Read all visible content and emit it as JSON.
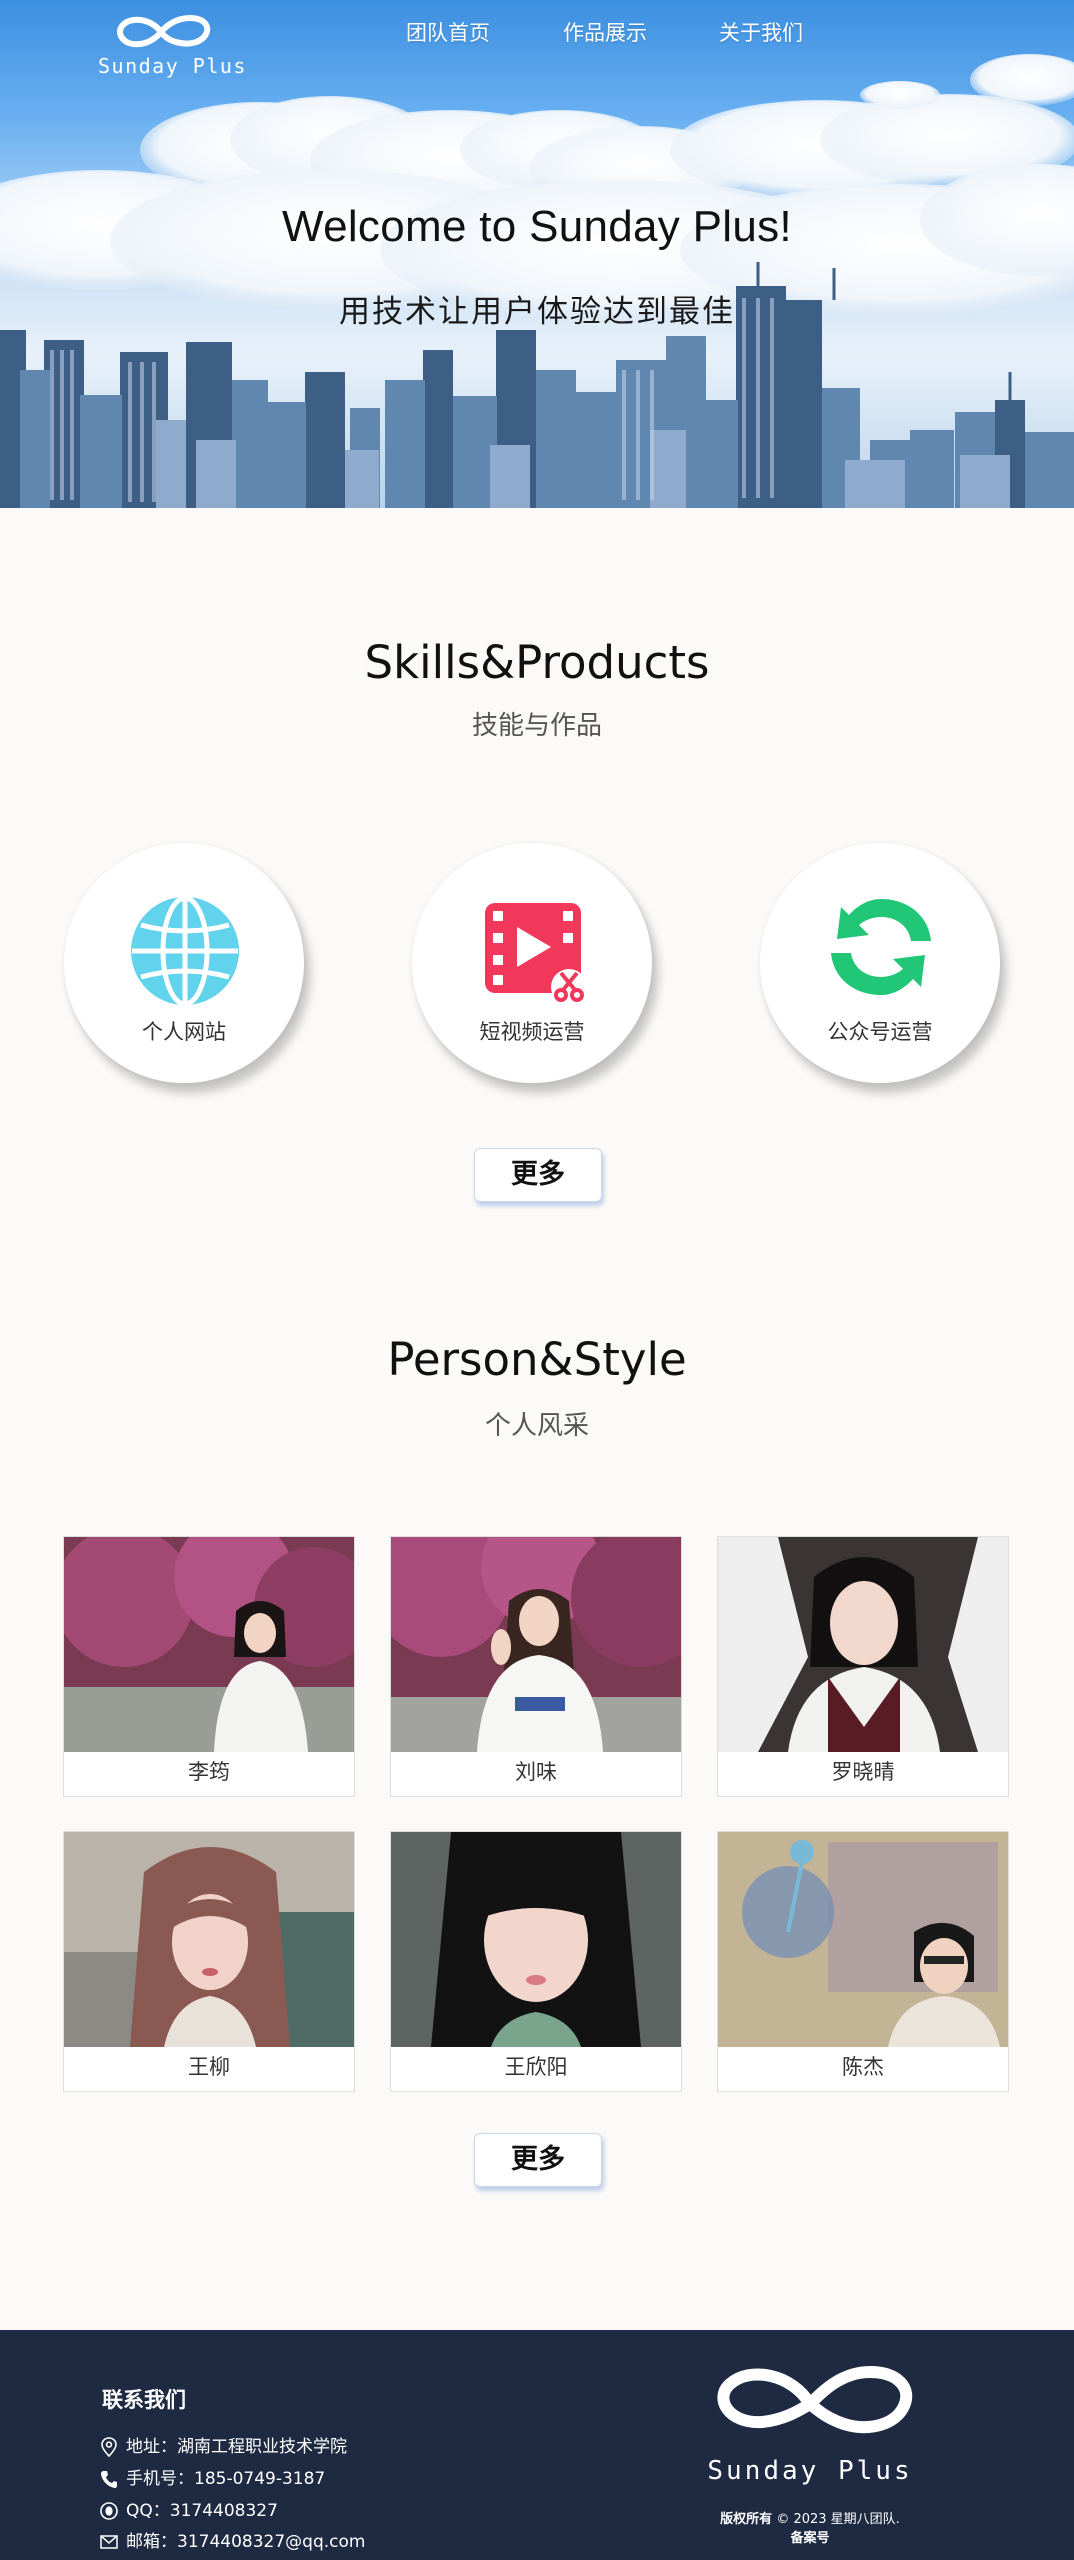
{
  "brand": {
    "logo_text": "Sunday Plus",
    "logo_icon": "infinity-icon"
  },
  "nav": {
    "items": [
      {
        "label": "团队首页"
      },
      {
        "label": "作品展示"
      },
      {
        "label": "关于我们"
      }
    ]
  },
  "hero": {
    "title": "Welcome to Sunday Plus!",
    "subtitle": "用技术让用户体验达到最佳"
  },
  "skills": {
    "title": "Skills&Products",
    "subtitle": "技能与作品",
    "items": [
      {
        "label": "个人网站",
        "icon": "globe-icon",
        "color": "#62d3ec"
      },
      {
        "label": "短视频运营",
        "icon": "video-editing-icon",
        "color": "#f2385a"
      },
      {
        "label": "公众号运营",
        "icon": "wechat-official-account-icon",
        "color": "#21c777"
      }
    ],
    "more_label": "更多"
  },
  "people": {
    "title": "Person&Style",
    "subtitle": "个人风采",
    "members": [
      {
        "name": "李筠"
      },
      {
        "name": "刘味"
      },
      {
        "name": "罗晓晴"
      },
      {
        "name": "王柳"
      },
      {
        "name": "王欣阳"
      },
      {
        "name": "陈杰"
      }
    ],
    "more_label": "更多"
  },
  "footer": {
    "contact_title": "联系我们",
    "address": {
      "label": "地址：",
      "value": "湖南工程职业技术学院",
      "icon": "location-pin-icon"
    },
    "phone": {
      "label": "手机号：",
      "value": "185-0749-3187",
      "icon": "phone-icon"
    },
    "qq": {
      "label": "QQ：",
      "value": "3174408327",
      "icon": "qq-icon"
    },
    "email": {
      "label": "邮箱：",
      "value": "3174408327@qq.com",
      "icon": "mail-icon"
    },
    "logo_text": "Sunday Plus",
    "copyright_strong": "版权所有",
    "copyright_rest": " © 2023 星期八团队.",
    "icp": "备案号"
  },
  "colors": {
    "footer_bg": "#1e2942",
    "page_bg": "#fbfaf8",
    "button_border": "#c8d6ee"
  }
}
